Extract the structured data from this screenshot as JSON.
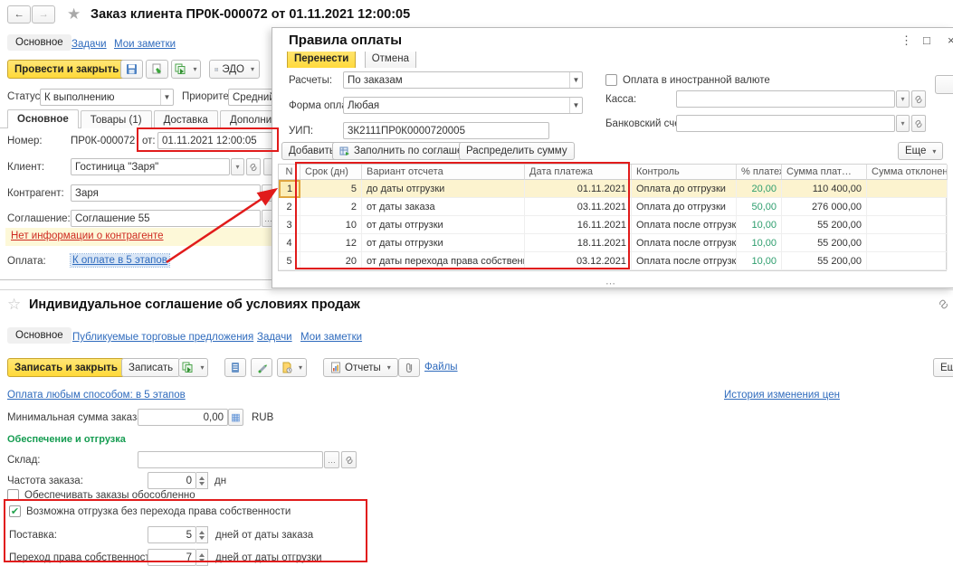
{
  "window1": {
    "title": "Заказ клиента ПР0К-000072 от 01.11.2021 12:00:05",
    "nav": {
      "main": "Основное",
      "tasks": "Задачи",
      "notes": "Мои заметки"
    },
    "toolbar": {
      "post_close": "Провести и закрыть",
      "edo": "ЭДО"
    },
    "status": {
      "label": "Статус:",
      "value": "К выполнению"
    },
    "priority": {
      "label": "Приоритет:",
      "value": "Средний"
    },
    "tabs": [
      "Основное",
      "Товары (1)",
      "Доставка",
      "Дополнительно"
    ],
    "fields": {
      "number_label": "Номер:",
      "number": "ПР0К-000072",
      "date_label": "от:",
      "date": "01.11.2021 12:00:05",
      "client_label": "Клиент:",
      "client": "Гостиница \"Заря\"",
      "counterparty_label": "Контрагент:",
      "counterparty": "Заря",
      "agreement_label": "Соглашение:",
      "agreement": "Соглашение 55"
    },
    "warning": "Нет информации о контрагенте",
    "payment": {
      "label": "Оплата:",
      "link": "К оплате в 5 этапов"
    }
  },
  "dialog": {
    "title": "Правила оплаты",
    "buttons": {
      "transfer": "Перенести",
      "cancel": "Отмена",
      "add": "Добавить",
      "fill_by_agreement": "Заполнить по соглашению",
      "distribute": "Распределить сумму",
      "more": "Еще"
    },
    "fields": {
      "settlements_label": "Расчеты:",
      "settlements": "По заказам",
      "payment_form_label": "Форма оплаты:",
      "payment_form": "Любая",
      "uip_label": "УИП:",
      "uip": "3К2111ПР0К0000720005",
      "foreign_currency_label": "Оплата в иностранной валюте",
      "cashbox_label": "Касса:",
      "bank_account_label": "Банковский счет:"
    },
    "table": {
      "headers": {
        "n": "N",
        "days": "Срок (дн)",
        "variant": "Вариант отсчета",
        "date": "Дата платежа",
        "control": "Контроль",
        "percent": "% платежа",
        "amount": "Сумма плат…",
        "deviation": "Сумма отклонения"
      },
      "rows": [
        {
          "n": "1",
          "days": "5",
          "variant": "до даты отгрузки",
          "date": "01.11.2021",
          "control": "Оплата до отгрузки",
          "percent": "20,00",
          "amount": "110 400,00",
          "deviation": ""
        },
        {
          "n": "2",
          "days": "2",
          "variant": "от даты заказа",
          "date": "03.11.2021",
          "control": "Оплата до отгрузки",
          "percent": "50,00",
          "amount": "276 000,00",
          "deviation": ""
        },
        {
          "n": "3",
          "days": "10",
          "variant": "от даты отгрузки",
          "date": "16.11.2021",
          "control": "Оплата после отгрузки",
          "percent": "10,00",
          "amount": "55 200,00",
          "deviation": ""
        },
        {
          "n": "4",
          "days": "12",
          "variant": "от даты отгрузки",
          "date": "18.11.2021",
          "control": "Оплата после отгрузки",
          "percent": "10,00",
          "amount": "55 200,00",
          "deviation": ""
        },
        {
          "n": "5",
          "days": "20",
          "variant": "от даты перехода права собственности",
          "date": "03.12.2021",
          "control": "Оплата после отгрузки",
          "percent": "10,00",
          "amount": "55 200,00",
          "deviation": ""
        }
      ]
    }
  },
  "window2": {
    "title": "Индивидуальное соглашение об условиях продаж",
    "nav": {
      "main": "Основное",
      "offers": "Публикуемые торговые предложения",
      "tasks": "Задачи",
      "notes": "Мои заметки"
    },
    "toolbar": {
      "save_close": "Записать и закрыть",
      "save": "Записать",
      "reports": "Отчеты",
      "files": "Файлы",
      "more": "Еще"
    },
    "payment_link": "Оплата любым способом: в 5 этапов",
    "price_history_link": "История изменения цен",
    "fields": {
      "min_sum_label": "Минимальная сумма заказа:",
      "min_sum": "0,00",
      "currency": "RUB",
      "section_header": "Обеспечение и отгрузка",
      "warehouse_label": "Склад:",
      "order_freq_label": "Частота заказа:",
      "order_freq": "0",
      "order_freq_unit": "дн",
      "separate_orders_label": "Обеспечивать заказы обособленно",
      "shipment_label": "Возможна отгрузка без перехода права собственности",
      "delivery_label": "Поставка:",
      "delivery": "5",
      "delivery_unit": "дней от даты заказа",
      "ownership_label": "Переход права собственности:",
      "ownership": "7",
      "ownership_unit": "дней от даты отгрузки"
    }
  },
  "icons": {
    "back": "←",
    "forward": "→",
    "star": "★",
    "star_outline": "☆",
    "more_vert": "⋮",
    "maximize": "□",
    "close": "×",
    "calc": "▦",
    "grip": "⋯"
  },
  "colors": {
    "accent_yellow": "#ffd939",
    "annotation_red": "#e11b1b",
    "link_blue": "#2f6bbd",
    "green_value": "#2e9e6e",
    "section_green": "#159c51"
  }
}
